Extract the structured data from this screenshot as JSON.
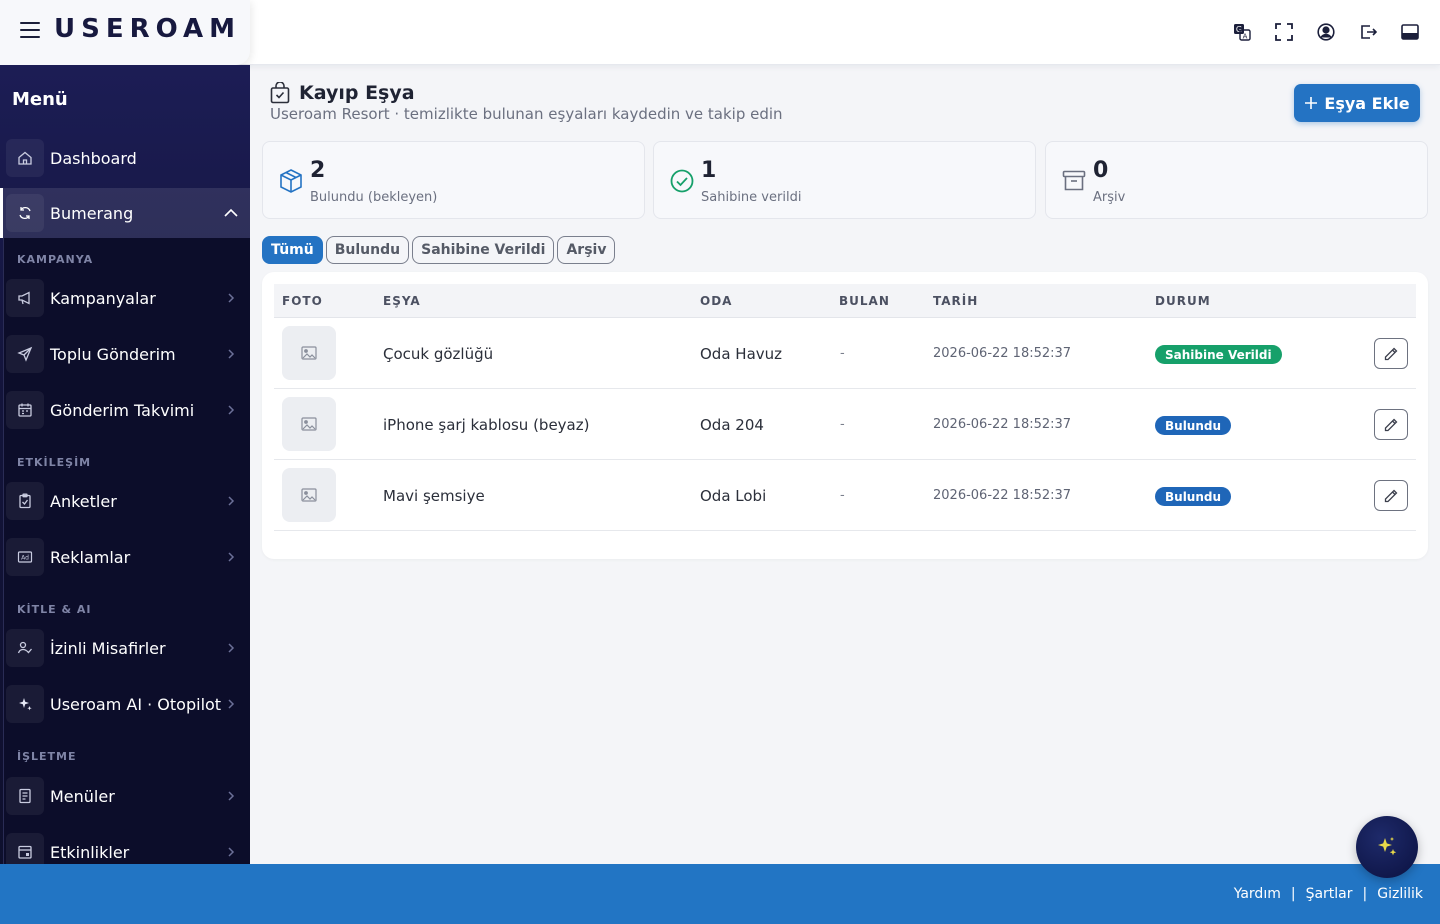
{
  "topbar": {
    "logo": "USEROAM",
    "icons": [
      "translate-icon",
      "fullscreen-icon",
      "user-circle-icon",
      "logout-icon",
      "layout-toggle-icon"
    ]
  },
  "sidebar": {
    "title": "Menü",
    "items": [
      {
        "label": "Dashboard",
        "icon": "home-icon"
      },
      {
        "label": "Bumerang",
        "icon": "refresh-icon"
      }
    ],
    "sections": [
      {
        "label": "KAMPANYA",
        "items": [
          {
            "label": "Kampanyalar",
            "icon": "megaphone-icon"
          },
          {
            "label": "Toplu Gönderim",
            "icon": "send-icon"
          },
          {
            "label": "Gönderim Takvimi",
            "icon": "calendar-icon"
          }
        ]
      },
      {
        "label": "ETKİLEŞİM",
        "items": [
          {
            "label": "Anketler",
            "icon": "clipboard-icon"
          },
          {
            "label": "Reklamlar",
            "icon": "ad-icon"
          }
        ]
      },
      {
        "label": "KİTLE & AI",
        "items": [
          {
            "label": "İzinli Misafirler",
            "icon": "user-check-icon"
          },
          {
            "label": "Useroam AI · Otopilot",
            "icon": "sparkle-icon"
          }
        ]
      },
      {
        "label": "İŞLETME",
        "items": [
          {
            "label": "Menüler",
            "icon": "menu-book-icon"
          },
          {
            "label": "Etkinlikler",
            "icon": "event-icon"
          }
        ]
      }
    ]
  },
  "page": {
    "title": "Kayıp Eşya",
    "subtitle": "Useroam Resort · temizlikte bulunan eşyaları kaydedin ve takip edin",
    "add_button": "Eşya Ekle"
  },
  "stats": [
    {
      "value": "2",
      "label": "Bulundu (bekleyen)",
      "icon": "box-icon",
      "color": "#2473c3"
    },
    {
      "value": "1",
      "label": "Sahibine verildi",
      "icon": "check-circle-icon",
      "color": "#16a06a"
    },
    {
      "value": "0",
      "label": "Arşiv",
      "icon": "archive-icon",
      "color": "#6b7080"
    }
  ],
  "filters": [
    "Tümü",
    "Bulundu",
    "Sahibine Verildi",
    "Arşiv"
  ],
  "table": {
    "headers": [
      "FOTO",
      "EŞYA",
      "ODA",
      "BULAN",
      "TARİH",
      "DURUM"
    ],
    "rows": [
      {
        "item": "Çocuk gözlüğü",
        "room": "Oda Havuz",
        "finder": "-",
        "date": "2026-06-22 18:52:37",
        "status": "Sahibine Verildi",
        "status_color": "#16a06a"
      },
      {
        "item": "iPhone şarj kablosu (beyaz)",
        "room": "Oda 204",
        "finder": "-",
        "date": "2026-06-22 18:52:37",
        "status": "Bulundu",
        "status_color": "#1f66b8"
      },
      {
        "item": "Mavi şemsiye",
        "room": "Oda Lobi",
        "finder": "-",
        "date": "2026-06-22 18:52:37",
        "status": "Bulundu",
        "status_color": "#1f66b8"
      }
    ]
  },
  "footer": {
    "links": [
      "Yardım",
      "Şartlar",
      "Gizlilik"
    ],
    "separator": "|"
  }
}
